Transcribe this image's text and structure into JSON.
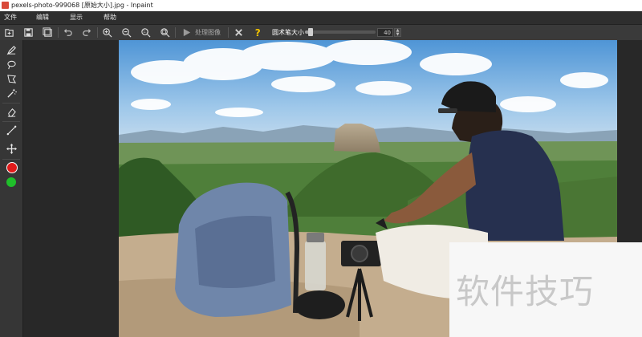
{
  "window": {
    "title": "pexels-photo-999068 [原始大小].jpg - Inpaint"
  },
  "menu": {
    "items": [
      "文件",
      "编辑",
      "显示",
      "帮助"
    ]
  },
  "toolbar": {
    "process_label": "处理图像",
    "brush_size_label": "圆术笔大小",
    "brush_size_value": "40",
    "brush_size_fraction": 0.04
  },
  "sidebar": {
    "colors": {
      "red": "#e01a1a",
      "green": "#1fbf2a"
    }
  },
  "watermark": {
    "text": "软件技巧"
  },
  "colors": {
    "accent_help": "#f2c200",
    "toolbar_bg": "#3a3a3a"
  }
}
